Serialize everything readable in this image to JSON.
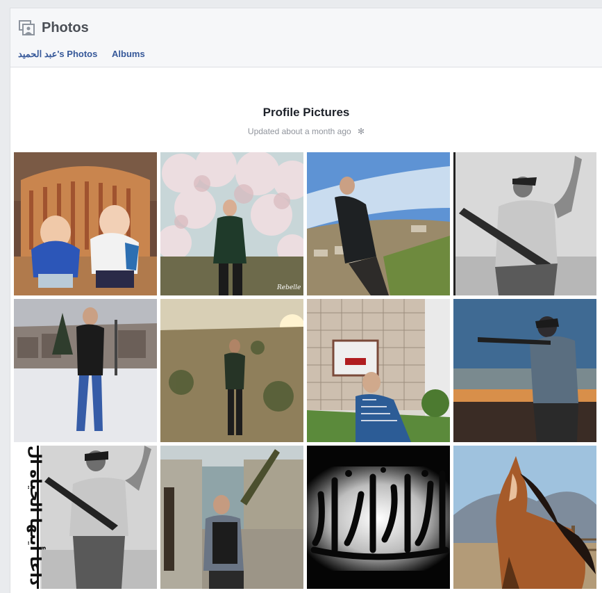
{
  "header": {
    "title": "Photos",
    "icon": "photos-icon",
    "tabs": [
      {
        "label": "عبد الحميد's Photos"
      },
      {
        "label": "Albums"
      }
    ]
  },
  "album": {
    "title": "Profile Pictures",
    "updated": "Updated about a month ago",
    "settings_icon": "gear-icon"
  },
  "photos": [
    {
      "description": "two toddlers on couch"
    },
    {
      "description": "man under blossom tree",
      "watermark": "Rebelle"
    },
    {
      "description": "man on hill"
    },
    {
      "description": "man with rifle grayscale"
    },
    {
      "description": "man in snow"
    },
    {
      "description": "man in field at sunset"
    },
    {
      "description": "man near stone wall"
    },
    {
      "description": "man aiming rifle at sunset"
    },
    {
      "description": "man with rifle and arabic text",
      "overlay_text": "داعا أيتها الحياة ال"
    },
    {
      "description": "man with rocket launcher"
    },
    {
      "description": "calligraphy banner"
    },
    {
      "description": "horse"
    }
  ],
  "colors": {
    "link": "#365899",
    "title": "#4b4f56",
    "page_bg": "#e9ebee"
  }
}
